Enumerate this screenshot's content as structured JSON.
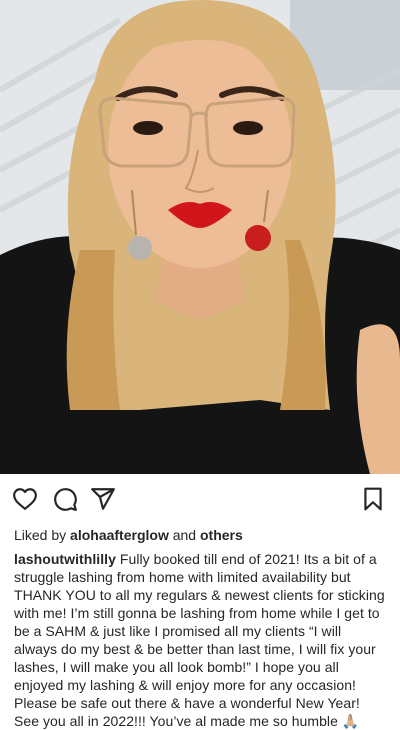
{
  "post": {
    "image_alt": "Selfie photo",
    "likes": {
      "prefix": "Liked by",
      "user": "alohaafterglow",
      "connector": "and",
      "others": "others"
    },
    "caption": {
      "username": "lashoutwithlilly",
      "text": "Fully booked till end of 2021! Its a bit of a struggle lashing from home with limited availability but THANK YOU to all my regulars & newest clients for sticking with me! I’m still gonna be lashing from home while I get to be a SAHM & just like I promised all my clients “I will always do my best & be better than last time, I will fix your lashes, I will make you all look bomb!” I hope you all enjoyed my lashing & will enjoy more for any occasion! Please be safe out there & have a wonderful New Year! See you all in 2022!!! You’ve al made me so humble 🙏🏼"
    },
    "icons": [
      "heart-icon",
      "comment-icon",
      "share-icon",
      "bookmark-icon"
    ]
  },
  "colors": {
    "text": "#262626",
    "icon": "#262626",
    "lipstick": "#d0161b",
    "ornament_red": "#c81e1e"
  }
}
